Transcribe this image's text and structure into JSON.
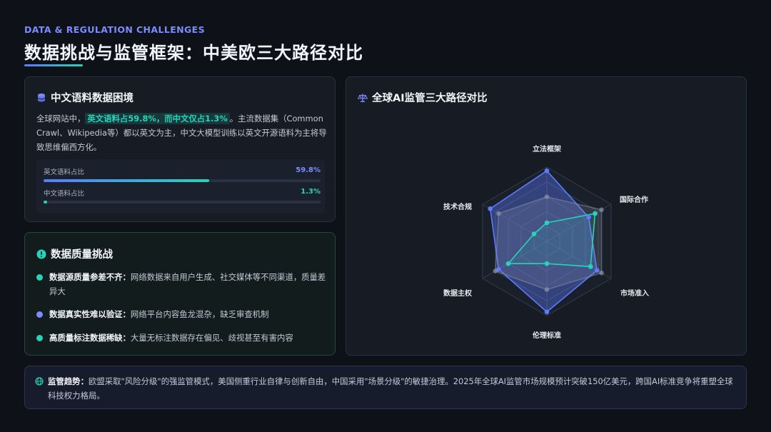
{
  "header": {
    "eyebrow": "DATA & REGULATION CHALLENGES",
    "title": "数据挑战与监管框架：中美欧三大路径对比"
  },
  "corpus": {
    "title": "中文语料数据困境",
    "desc_prefix": "全球网站中，",
    "desc_highlight": "英文语料占59.8%，而中文仅占1.3%",
    "desc_suffix": "。主流数据集（Common Crawl、Wikipedia等）都以英文为主，中文大模型训练以英文开源语料为主将导致思维偏西方化。",
    "bars": [
      {
        "label": "英文语料占比",
        "value_text": "59.8%",
        "value": 59.8
      },
      {
        "label": "中文语料占比",
        "value_text": "1.3%",
        "value": 1.3
      }
    ],
    "colors": {
      "english": "#5b7bff",
      "chinese": "#27d3b8"
    }
  },
  "quality": {
    "title": "数据质量挑战",
    "items": [
      {
        "bold": "数据源质量参差不齐：",
        "text": "网络数据来自用户生成、社交媒体等不同渠道，质量差异大",
        "color": "#27d3b8"
      },
      {
        "bold": "数据真实性难以验证：",
        "text": "网络平台内容鱼龙混杂，缺乏审查机制",
        "color": "#7b8cff"
      },
      {
        "bold": "高质量标注数据稀缺：",
        "text": "大量无标注数据存在偏见、歧视甚至有害内容",
        "color": "#27d3b8"
      }
    ]
  },
  "radar": {
    "title": "全球AI监管三大路径对比"
  },
  "chart_data": {
    "type": "radar",
    "title": "全球AI监管三大路径对比",
    "axes": [
      "立法框架",
      "国际合作",
      "市场准入",
      "伦理标准",
      "数据主权",
      "技术合规"
    ],
    "range": [
      0,
      10
    ],
    "grid_levels": 5,
    "series": [
      {
        "values": [
          9.5,
          6.5,
          7.8,
          9.5,
          7.5,
          8.8
        ],
        "color": "#5b7bff"
      },
      {
        "values": [
          2.5,
          7.5,
          6.8,
          3.0,
          6.0,
          2.0
        ],
        "color": "#27d3b8"
      },
      {
        "values": [
          6.0,
          8.5,
          8.5,
          6.5,
          8.0,
          7.5
        ],
        "color": "#8a93a8"
      }
    ]
  },
  "trend": {
    "bold": "监管趋势：",
    "text": "欧盟采取\"风险分级\"的强监管模式，美国侧重行业自律与创新自由，中国采用\"场景分级\"的敏捷治理。2025年全球AI监管市场规模预计突破150亿美元，跨国AI标准竞争将重塑全球科技权力格局。"
  }
}
